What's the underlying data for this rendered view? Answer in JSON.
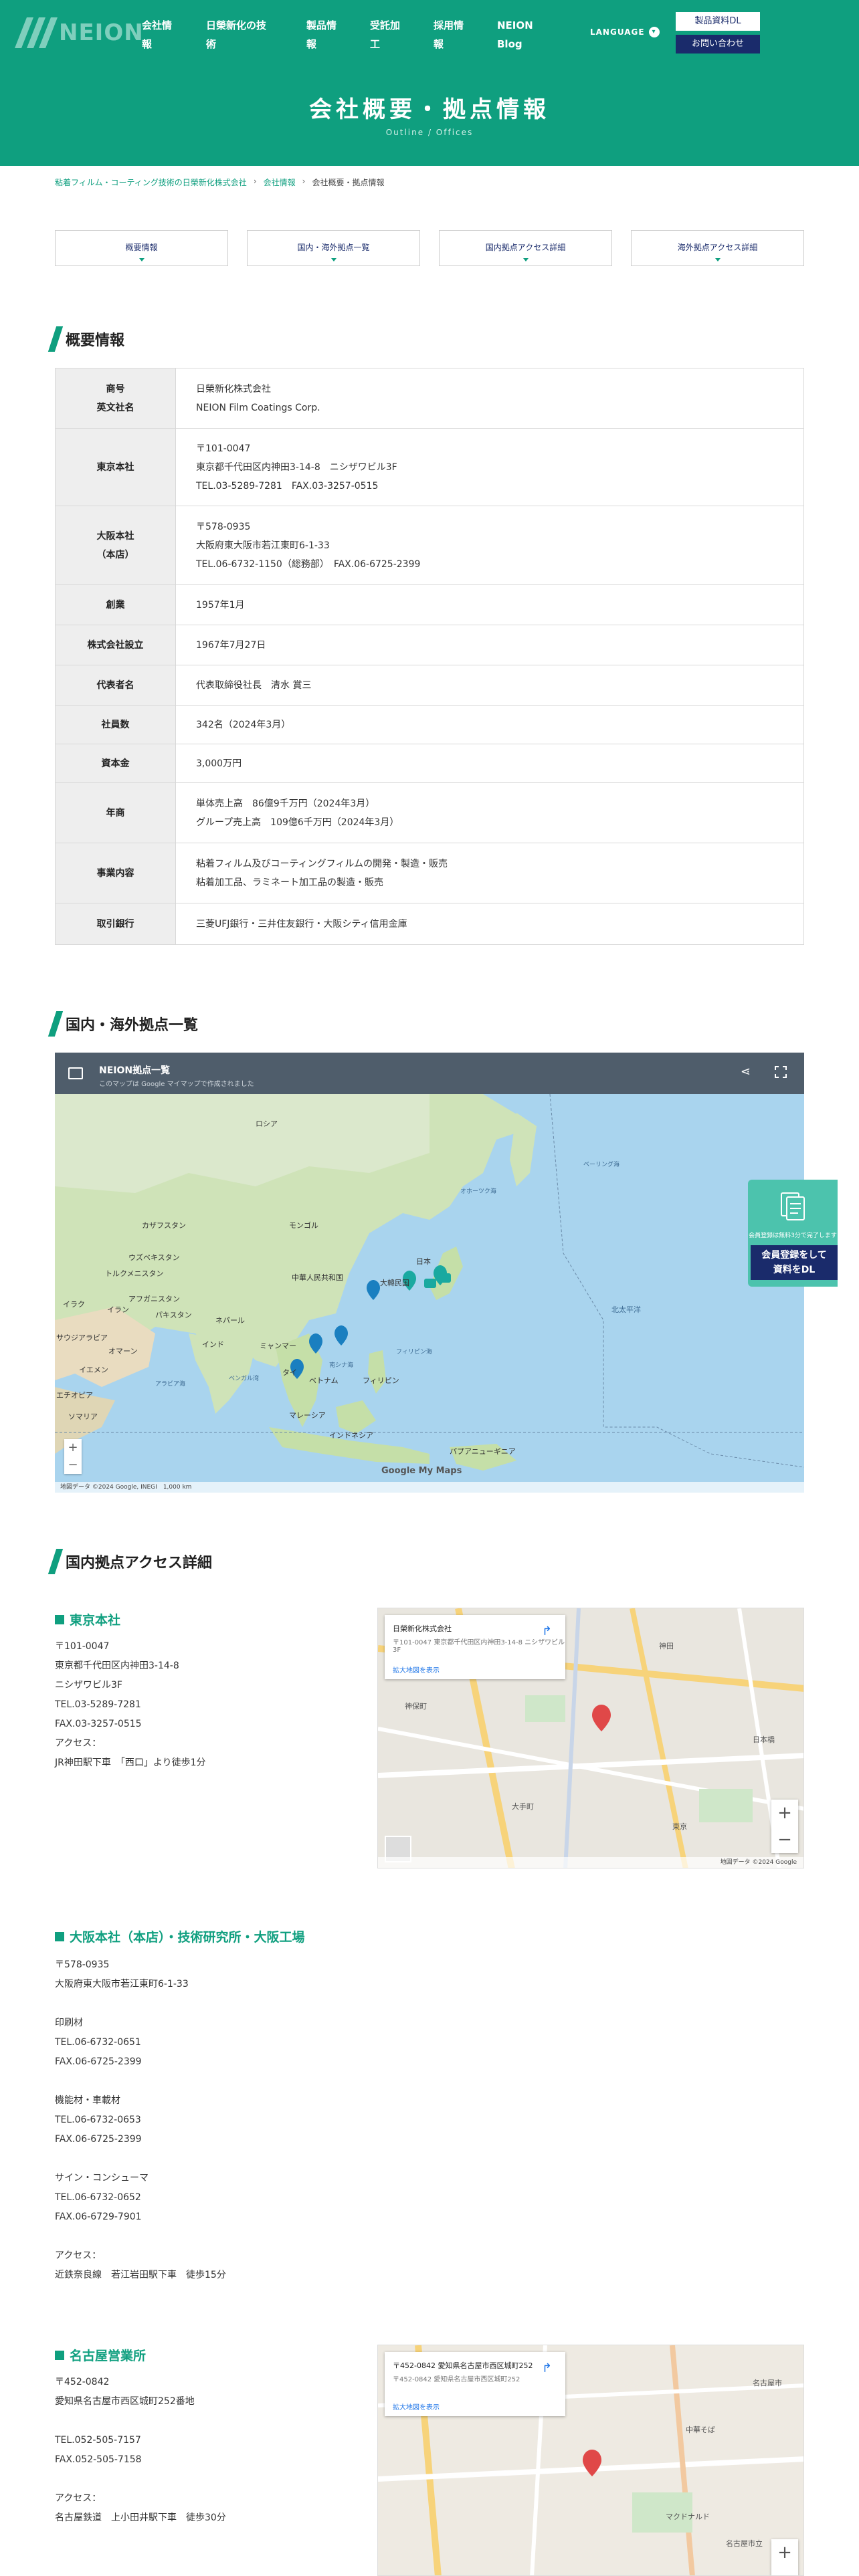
{
  "header": {
    "logo_text": "NEION",
    "nav": [
      "会社情報",
      "日榮新化の技術",
      "製品情報",
      "受託加工",
      "採用情報",
      "NEION Blog"
    ],
    "nav_lines": [
      [
        "会社情",
        "報"
      ],
      [
        "日榮新化の技",
        "術"
      ],
      [
        "製品情",
        "報"
      ],
      [
        "受託加",
        "工"
      ],
      [
        "採用情",
        "報"
      ],
      [
        "NEION",
        "Blog"
      ]
    ],
    "language": "LANGUAGE",
    "btn_download": "製品資料DL",
    "btn_contact": "お問い合わせ"
  },
  "hero": {
    "title": "会社概要・拠点情報",
    "subtitle": "Outline / Offices"
  },
  "breadcrumb": [
    "粘着フィルム・コーティング技術の日榮新化株式会社",
    "会社情報",
    "会社概要・拠点情報"
  ],
  "tabs": [
    "概要情報",
    "国内・海外拠点一覧",
    "国内拠点アクセス詳細",
    "海外拠点アクセス詳細"
  ],
  "overview": {
    "heading": "概要情報",
    "rows": [
      {
        "key": [
          "商号",
          "英文社名"
        ],
        "value": [
          "日榮新化株式会社",
          "NEION Film Coatings Corp."
        ]
      },
      {
        "key": [
          "東京本社"
        ],
        "value": [
          "〒101-0047",
          "東京都千代田区内神田3-14-8　ニシザワビル3F",
          "TEL.03-5289-7281　FAX.03-3257-0515"
        ]
      },
      {
        "key": [
          "大阪本社",
          "（本店）"
        ],
        "value": [
          "〒578-0935",
          "大阪府東大阪市若江東町6-1-33",
          "TEL.06-6732-1150（総務部）　FAX.06-6725-2399"
        ]
      },
      {
        "key": [
          "創業"
        ],
        "value": [
          "1957年1月"
        ]
      },
      {
        "key": [
          "株式会社設立"
        ],
        "value": [
          "1967年7月27日"
        ]
      },
      {
        "key": [
          "代表者名"
        ],
        "value": [
          "代表取締役社長　清水 賞三"
        ]
      },
      {
        "key": [
          "社員数"
        ],
        "value": [
          "342名（2024年3月）"
        ]
      },
      {
        "key": [
          "資本金"
        ],
        "value": [
          "3,000万円"
        ]
      },
      {
        "key": [
          "年商"
        ],
        "value": [
          "単体売上高　86億9千万円（2024年3月）",
          "グループ売上高　109億6千万円（2024年3月）"
        ]
      },
      {
        "key": [
          "事業内容"
        ],
        "value": [
          "粘着フィルム及びコーティングフィルムの開発・製造・販売",
          "粘着加工品、ラミネート加工品の製造・販売"
        ]
      },
      {
        "key": [
          "取引銀行"
        ],
        "value": [
          "三菱UFJ銀行・三井住友銀行・大阪シティ信用金庫"
        ]
      }
    ]
  },
  "locations": {
    "heading": "国内・海外拠点一覧",
    "map_title": "NEION拠点一覧 ",
    "map_subtitle": "このマップは Google マイマップで作成されました",
    "map_labels": [
      "ロシア",
      "モンゴル",
      "カザフスタン",
      "ウズベキスタン",
      "トルクメニスタン",
      "イラク",
      "イラン",
      "アフガニスタン",
      "パキスタン",
      "ネパール",
      "インド",
      "サウジアラビア",
      "オマーン",
      "イエメン",
      "エチオピア",
      "ソマリア",
      "中華人民共和国",
      "大韓民国",
      "日本",
      "ミャンマー",
      "タイ",
      "ベトナム",
      "フィリピン",
      "マレーシア",
      "インドネシア",
      "パプアニューギニア",
      "北太平洋",
      "オホーツク海",
      "ベーリング海",
      "フィリピン海",
      "南シナ海",
      "ベンガル湾",
      "アラビア海"
    ],
    "map_footer": "地図データ ©2024 Google, INEGI",
    "map_scale": "1,000 km",
    "google_label": "Google My Maps"
  },
  "side_banner": {
    "small_text": "会員登録は無料3分で完了します",
    "cta_line1": "会員登録をして",
    "cta_line2": "資料をDL"
  },
  "domestic": {
    "heading": "国内拠点アクセス詳細",
    "offices": [
      {
        "name": "東京本社",
        "lines": [
          "〒101-0047",
          "東京都千代田区内神田3-14-8",
          "ニシザワビル3F",
          "TEL.03-5289-7281",
          "FAX.03-3257-0515",
          "アクセス：",
          "JR神田駅下車　「西口」より徒歩1分"
        ],
        "map_card": [
          "日榮新化株式会社",
          "〒101-0047 東京都千代田区内神田3-14-8 ニシザワビル3F",
          "拡大地図を表示"
        ],
        "map_labels": [
          "神田",
          "東京",
          "日本橋",
          "大手町",
          "神保町"
        ]
      },
      {
        "name": "大阪本社（本店）・技術研究所・大阪工場",
        "lines": [
          "〒578-0935",
          "大阪府東大阪市若江東町6-1-33",
          "",
          "印刷材",
          "TEL.06-6732-0651",
          "FAX.06-6725-2399",
          "",
          "機能材・車載材",
          "TEL.06-6732-0653",
          "FAX.06-6725-2399",
          "",
          "サイン・コンシューマ",
          "TEL.06-6732-0652",
          "FAX.06-6729-7901",
          "",
          "アクセス：",
          "近鉄奈良線　若江岩田駅下車　徒歩15分"
        ]
      },
      {
        "name": "名古屋営業所",
        "lines": [
          "〒452-0842",
          "愛知県名古屋市西区城町252番地",
          "",
          "TEL.052-505-7157",
          "FAX.052-505-7158",
          "",
          "アクセス：",
          "名古屋鉄道　上小田井駅下車　徒歩30分"
        ],
        "map_card": [
          "〒452-0842 愛知県名古屋市西区城町252",
          "〒452-0842 愛知県名古屋市西区城町252",
          "拡大地図を表示"
        ],
        "map_labels": [
          "名古屋市",
          "中華そば",
          "名古屋市立",
          "マクドナルド"
        ]
      }
    ],
    "map_footer": "地図データ ©2024 Google"
  },
  "colors": {
    "brand": "#0f9f7f",
    "navy": "#1a2b6b",
    "pin": "#1aa9a0"
  }
}
